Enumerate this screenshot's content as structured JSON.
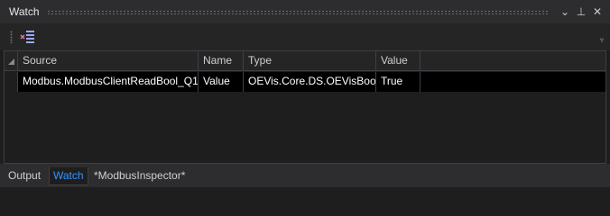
{
  "window": {
    "title": "Watch",
    "buttons": {
      "dropdown": "⌄",
      "pin": "⊥",
      "close": "✕"
    }
  },
  "toolbar": {
    "clear_icon": "clear-list-icon",
    "overflow": "▿"
  },
  "grid": {
    "columns": [
      "Source",
      "Name",
      "Type",
      "Value"
    ],
    "rows": [
      {
        "source": "Modbus.ModbusClientReadBool_Q1",
        "name": "Value",
        "type": "OEVis.Core.DS.OEVisBools",
        "value": "True"
      }
    ]
  },
  "tabs": [
    {
      "label": "Output",
      "active": false
    },
    {
      "label": "Watch",
      "active": true
    },
    {
      "label": "*ModbusInspector*",
      "active": false
    }
  ],
  "colors": {
    "accent": "#3794ff",
    "background": "#1e1e1e",
    "row_selected": "#000000"
  }
}
